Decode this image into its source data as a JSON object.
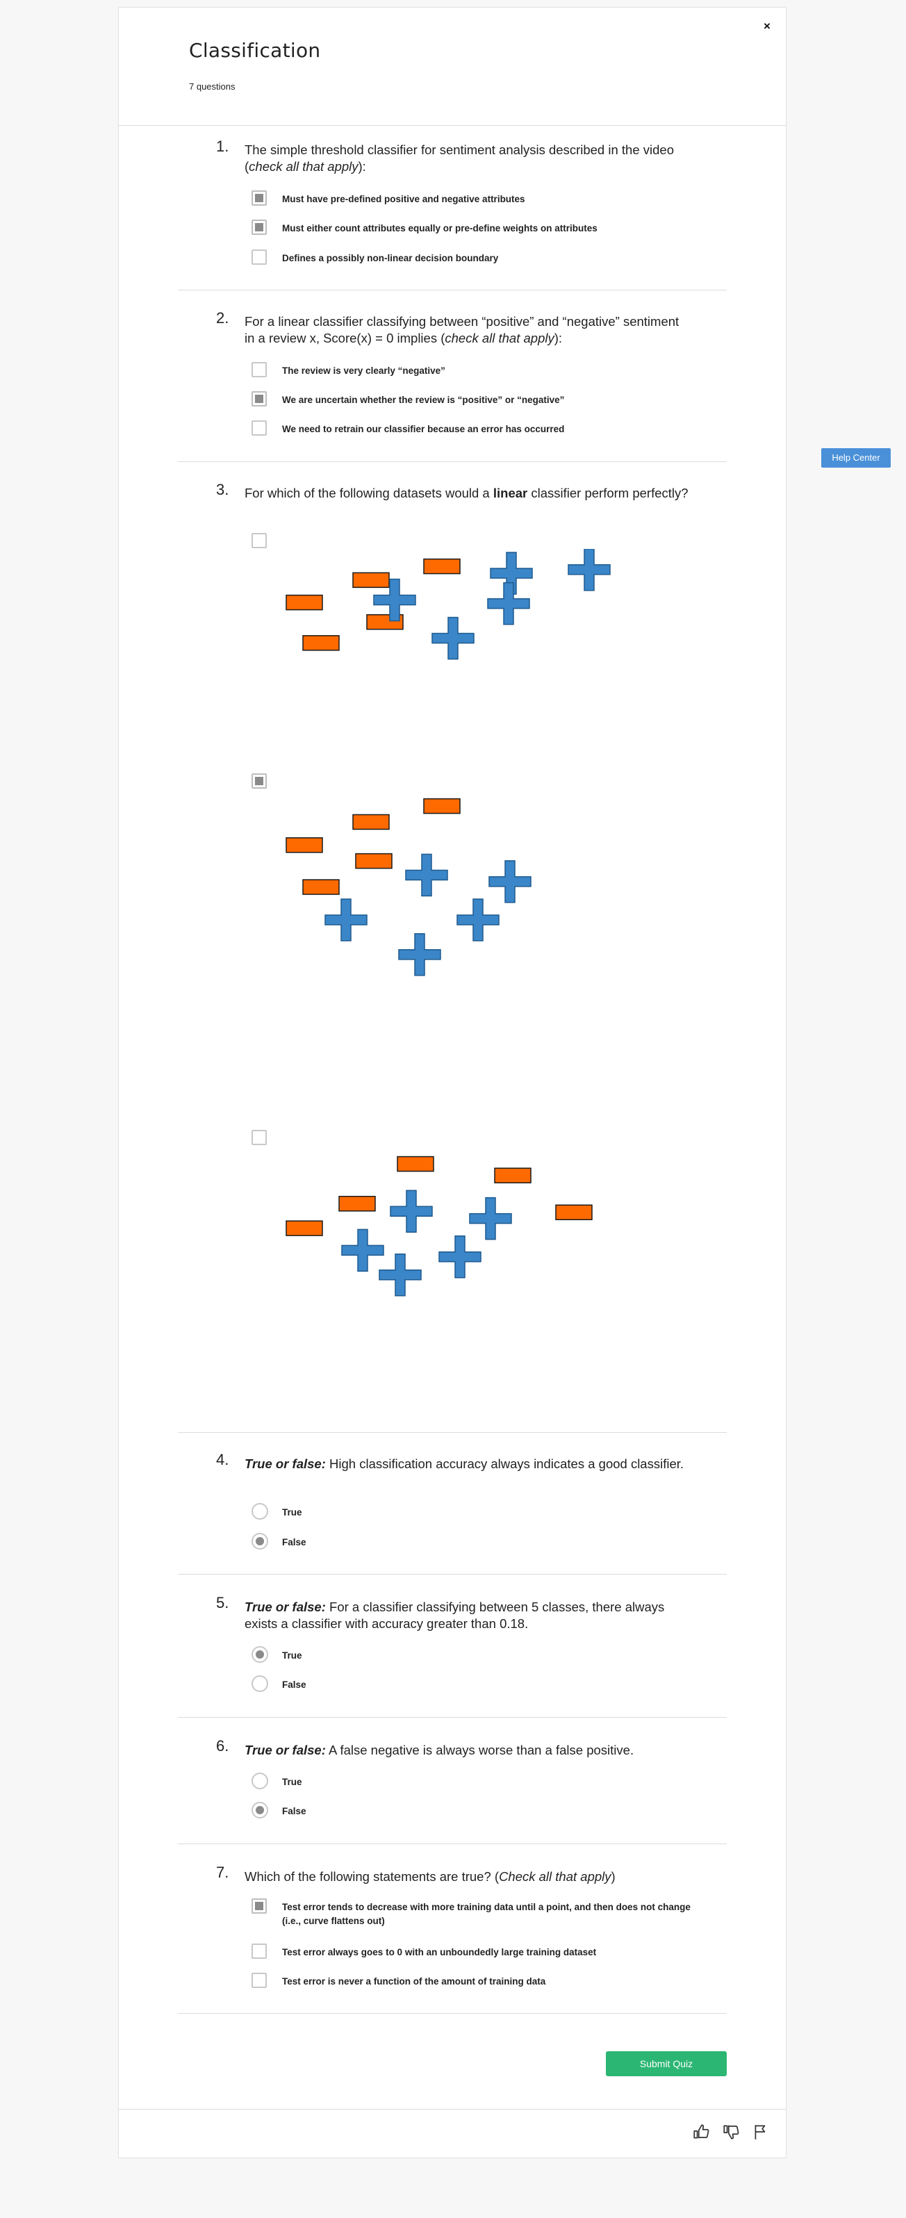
{
  "quiz": {
    "title": "Classification",
    "question_count": "7 questions",
    "close_symbol": "×",
    "submit_label": "Submit Quiz",
    "help_center_label": "Help Center"
  },
  "footer": {
    "icons": [
      "thumbs-up-icon",
      "thumbs-down-icon",
      "flag-icon"
    ]
  },
  "questions": [
    {
      "number": "1.",
      "text_parts": [
        "The simple threshold classifier for sentiment analysis described in the video (",
        "check all that apply",
        "):"
      ],
      "type": "checkbox",
      "options": [
        {
          "label": "Must have pre-defined positive and negative attributes",
          "checked": true
        },
        {
          "label": "Must either count attributes equally or pre-define weights on attributes",
          "checked": true
        },
        {
          "label": "Defines a possibly non-linear decision boundary",
          "checked": false
        }
      ]
    },
    {
      "number": "2.",
      "text_parts": [
        "For a linear classifier classifying between “positive” and “negative” sentiment in a review x, Score(x) = 0 implies (",
        "check all that apply",
        "):"
      ],
      "type": "checkbox",
      "options": [
        {
          "label": "The review is very clearly “negative”",
          "checked": false
        },
        {
          "label": "We are uncertain whether the review is “positive” or “negative”",
          "checked": true
        },
        {
          "label": "We need to retrain our classifier because an error has occurred",
          "checked": false
        }
      ]
    },
    {
      "number": "3.",
      "text_parts": [
        "For which of the following datasets would a ",
        "linear",
        " classifier perform perfectly?"
      ],
      "type": "checkbox",
      "options": [
        {
          "label": "",
          "checked": false
        },
        {
          "label": "",
          "checked": true
        },
        {
          "label": "",
          "checked": false
        }
      ]
    },
    {
      "number": "4.",
      "text_parts": [
        "True or false:",
        " High classification accuracy always indicates a good classifier."
      ],
      "type": "radio",
      "options": [
        {
          "label": "True",
          "checked": false
        },
        {
          "label": "False",
          "checked": true
        }
      ]
    },
    {
      "number": "5.",
      "text_parts": [
        "True or false:",
        " For a classifier classifying between 5 classes, there always exists a classifier with accuracy greater than 0.18."
      ],
      "type": "radio",
      "options": [
        {
          "label": "True",
          "checked": true
        },
        {
          "label": "False",
          "checked": false
        }
      ]
    },
    {
      "number": "6.",
      "text_parts": [
        "True or false:",
        " A false negative is always worse than a false positive."
      ],
      "type": "radio",
      "options": [
        {
          "label": "True",
          "checked": false
        },
        {
          "label": "False",
          "checked": true
        }
      ]
    },
    {
      "number": "7.",
      "text_parts": [
        "Which of the following statements are true? (",
        "Check all that apply",
        ")"
      ],
      "type": "checkbox",
      "options": [
        {
          "label": "Test error tends to decrease with more training data until a point, and then does not change (i.e., curve flattens out)",
          "checked": true
        },
        {
          "label": "Test error always goes to 0 with an unboundedly large training dataset",
          "checked": false
        },
        {
          "label": "Test error is never a function of the amount of training data",
          "checked": false
        }
      ]
    }
  ],
  "colors": {
    "minus_marker": "#ff6a00",
    "plus_marker": "#3a86c8",
    "submit": "#2bb673",
    "help": "#4a90d9"
  },
  "datasets": [
    {
      "negatives": [
        [
          0.525,
          0.07
        ],
        [
          0.27,
          0.165
        ],
        [
          0.03,
          0.32
        ],
        [
          0.32,
          0.455
        ],
        [
          0.09,
          0.6
        ]
      ],
      "positives": [
        [
          0.84,
          0.12
        ],
        [
          0.42,
          0.305
        ],
        [
          0.63,
          0.57
        ],
        [
          0.83,
          0.33
        ],
        [
          1.12,
          0.095
        ]
      ]
    },
    {
      "negatives": [
        [
          0.525,
          0.07
        ],
        [
          0.27,
          0.18
        ],
        [
          0.03,
          0.34
        ],
        [
          0.28,
          0.45
        ],
        [
          0.09,
          0.63
        ]
      ],
      "positives": [
        [
          0.535,
          0.55
        ],
        [
          0.835,
          0.595
        ],
        [
          0.245,
          0.86
        ],
        [
          0.72,
          0.86
        ],
        [
          0.51,
          1.1
        ]
      ]
    },
    {
      "negatives": [
        [
          0.43,
          0.07
        ],
        [
          0.78,
          0.15
        ],
        [
          0.22,
          0.345
        ],
        [
          1.0,
          0.405
        ],
        [
          0.03,
          0.515
        ]
      ],
      "positives": [
        [
          0.48,
          0.4
        ],
        [
          0.765,
          0.45
        ],
        [
          0.305,
          0.67
        ],
        [
          0.655,
          0.715
        ],
        [
          0.44,
          0.84
        ]
      ]
    }
  ]
}
